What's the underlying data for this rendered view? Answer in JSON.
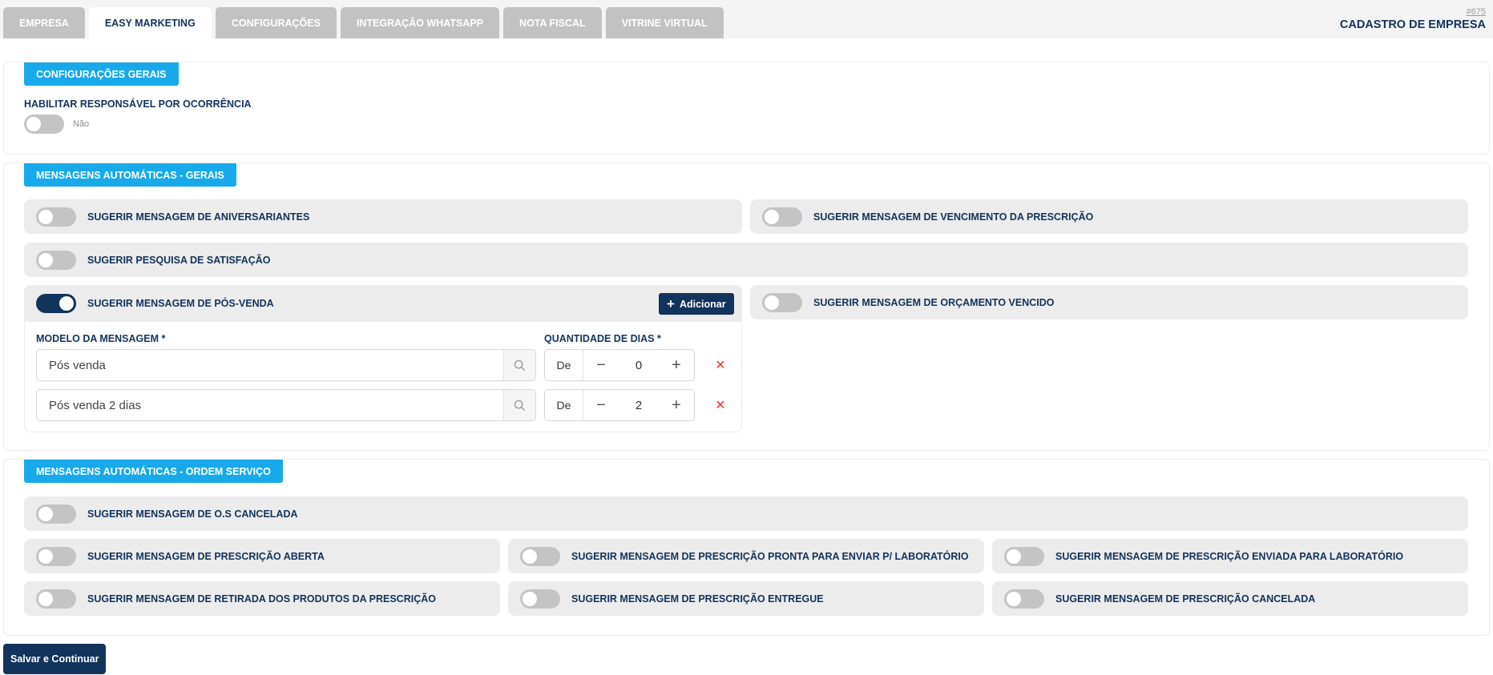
{
  "tabs": [
    "EMPRESA",
    "EASY MARKETING",
    "CONFIGURAÇÕES",
    "INTEGRAÇÃO WHATSAPP",
    "NOTA FISCAL",
    "VITRINE VIRTUAL"
  ],
  "header": {
    "record_id": "#675",
    "title": "CADASTRO DE EMPRESA"
  },
  "config_gerais": {
    "badge": "CONFIGURAÇÕES GERAIS",
    "field_label": "HABILITAR RESPONSÁVEL POR OCORRÊNCIA",
    "toggle_state": "Não"
  },
  "msg_gerais": {
    "badge": "MENSAGENS AUTOMÁTICAS - GERAIS",
    "aniversariantes": "SUGERIR MENSAGEM DE ANIVERSARIANTES",
    "vencimento_prescricao": "SUGERIR MENSAGEM DE VENCIMENTO DA PRESCRIÇÃO",
    "pesquisa_satisfacao": "SUGERIR PESQUISA DE SATISFAÇÃO",
    "pos_venda": "SUGERIR MENSAGEM DE PÓS-VENDA",
    "orcamento_vencido": "SUGERIR MENSAGEM DE ORÇAMENTO VENCIDO",
    "add_label": "Adicionar",
    "modelo_label": "MODELO DA MENSAGEM *",
    "quantidade_label": "QUANTIDADE DE DIAS *",
    "prefix": "De",
    "rows": [
      {
        "modelo": "Pós venda",
        "dias": "0"
      },
      {
        "modelo": "Pós venda 2 dias",
        "dias": "2"
      }
    ]
  },
  "msg_os": {
    "badge": "MENSAGENS AUTOMÁTICAS - ORDEM SERVIÇO",
    "os_cancelada": "SUGERIR MENSAGEM DE O.S CANCELADA",
    "prescricao_aberta": "SUGERIR MENSAGEM DE PRESCRIÇÃO ABERTA",
    "prescricao_pronta": "SUGERIR MENSAGEM DE PRESCRIÇÃO PRONTA PARA ENVIAR P/ LABORATÓRIO",
    "prescricao_enviada": "SUGERIR MENSAGEM DE PRESCRIÇÃO ENVIADA PARA LABORATÓRIO",
    "retirada_produtos": "SUGERIR MENSAGEM DE RETIRADA DOS PRODUTOS DA PRESCRIÇÃO",
    "prescricao_entregue": "SUGERIR MENSAGEM DE PRESCRIÇÃO ENTREGUE",
    "prescricao_cancelada": "SUGERIR MENSAGEM DE PRESCRIÇÃO CANCELADA"
  },
  "footer": {
    "save_label": "Salvar e Continuar"
  },
  "colors": {
    "primary": "#12335b",
    "accent": "#17a9ea",
    "danger": "#e53935"
  }
}
